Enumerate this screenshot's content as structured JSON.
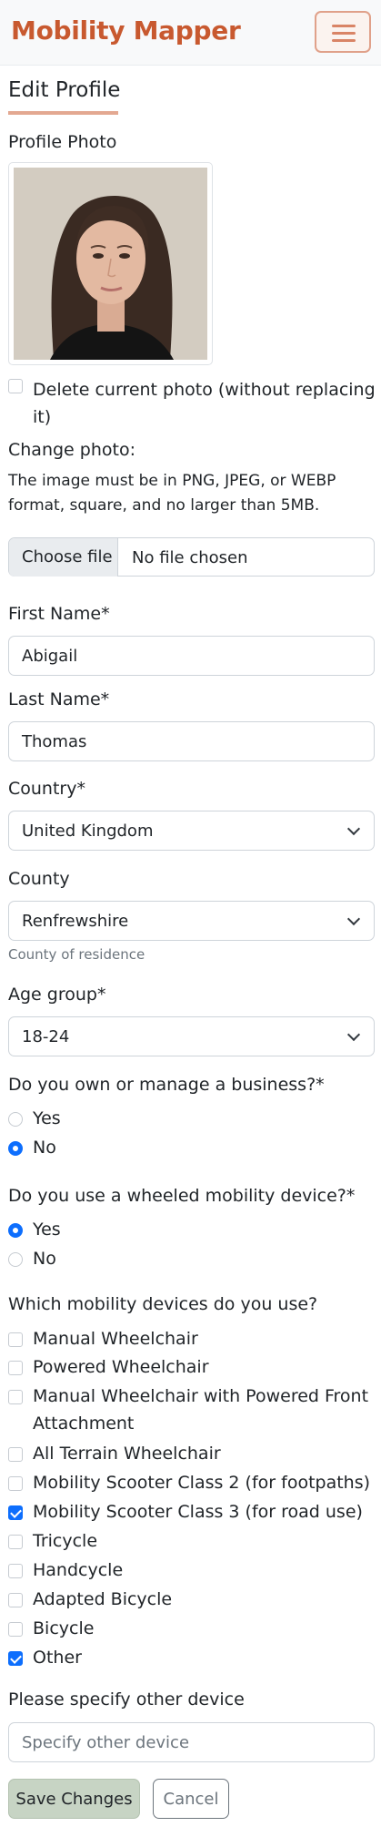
{
  "app": {
    "brand": "Mobility Mapper",
    "menu_icon": "hamburger-icon"
  },
  "page": {
    "title": "Edit Profile"
  },
  "photo": {
    "label": "Profile Photo",
    "delete_label": "Delete current photo (without replacing it)",
    "delete_checked": false,
    "change_label": "Change photo:",
    "help_text": "The image must be in PNG, JPEG, or WEBP format, square, and no larger than 5MB.",
    "choose_button": "Choose file",
    "file_status": "No file chosen"
  },
  "first_name": {
    "label": "First Name*",
    "value": "Abigail"
  },
  "last_name": {
    "label": "Last Name*",
    "value": "Thomas"
  },
  "country": {
    "label": "Country*",
    "value": "United Kingdom"
  },
  "county": {
    "label": "County",
    "value": "Renfrewshire",
    "help": "County of residence"
  },
  "age_group": {
    "label": "Age group*",
    "value": "18-24"
  },
  "business": {
    "question": "Do you own or manage a business?*",
    "options": [
      {
        "label": "Yes",
        "checked": false
      },
      {
        "label": "No",
        "checked": true
      }
    ]
  },
  "wheeled": {
    "question": "Do you use a wheeled mobility device?*",
    "options": [
      {
        "label": "Yes",
        "checked": true
      },
      {
        "label": "No",
        "checked": false
      }
    ]
  },
  "devices": {
    "question": "Which mobility devices do you use?",
    "items": [
      {
        "label": "Manual Wheelchair",
        "checked": false
      },
      {
        "label": "Powered Wheelchair",
        "checked": false
      },
      {
        "label": "Manual Wheelchair with Powered Front",
        "label2": "Attachment",
        "checked": false
      },
      {
        "label": "All Terrain Wheelchair",
        "checked": false
      },
      {
        "label": "Mobility Scooter Class 2 (for footpaths)",
        "checked": false
      },
      {
        "label": "Mobility Scooter Class 3 (for road use)",
        "checked": true
      },
      {
        "label": "Tricycle",
        "checked": false
      },
      {
        "label": "Handcycle",
        "checked": false
      },
      {
        "label": "Adapted Bicycle",
        "checked": false
      },
      {
        "label": "Bicycle",
        "checked": false
      },
      {
        "label": "Other",
        "checked": true
      }
    ]
  },
  "other_device": {
    "label": "Please specify other device",
    "placeholder": "Specify other device",
    "value": ""
  },
  "actions": {
    "save": "Save Changes",
    "cancel": "Cancel"
  },
  "colors": {
    "brand": "#c8592f",
    "accent": "#0d6efd",
    "save_bg": "#c7d4c4"
  }
}
